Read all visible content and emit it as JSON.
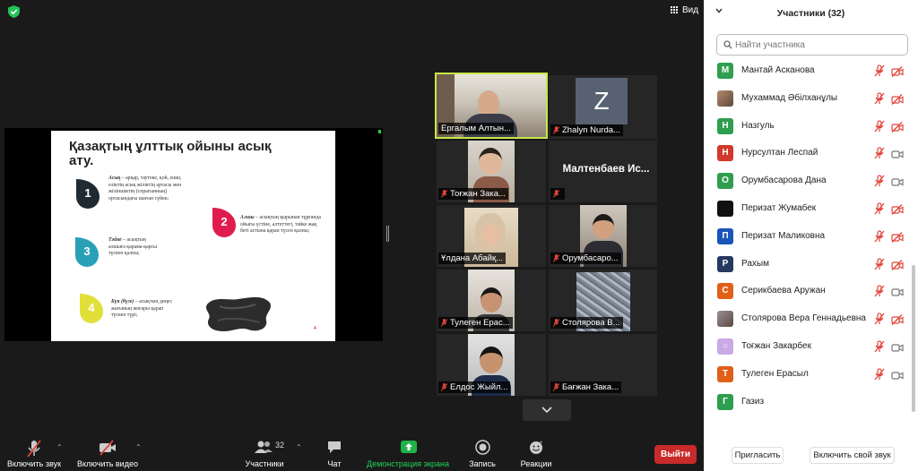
{
  "view_label": "Вид",
  "slide": {
    "title": "Қазақтың ұлттық ойыны асық ату.",
    "points": [
      {
        "num": "1",
        "term": "Асық",
        "text": " – арқар, таутеке, қой, ешкі, еліктің асық жіліктің артасы мен жіліншіктің (спрагынның) ортасындағы шағын сүйек;"
      },
      {
        "num": "2",
        "term": "Алшы",
        "text": " – асықтың қырынан тұрғанда ойығы үстіне, алтеттегі, тәйке жақ беті астына қарап түсен қалпы;"
      },
      {
        "num": "3",
        "term": "Тәйке",
        "text": " – асықтың алшыға қарама-қарсы түскен қалпы;"
      },
      {
        "num": "4",
        "term": "Бүк (бүге)",
        "text": " – асықтың дөңес жағының жоғары қарап түскен түрі;"
      }
    ],
    "page_num": "4"
  },
  "videos": [
    {
      "name": "Ергалым Алтын...",
      "kind": "photo",
      "active": true,
      "muted": false
    },
    {
      "name": "Zhalyn Nurda...",
      "kind": "avatar",
      "letter": "Z",
      "muted": true
    },
    {
      "name": "Тоғжан Зака...",
      "kind": "photo",
      "muted": true
    },
    {
      "name": "",
      "kind": "bigname",
      "big": "Малтенбаев Ис...",
      "muted": true
    },
    {
      "name": "Ұлдана Абайқ...",
      "kind": "photo",
      "muted": false
    },
    {
      "name": "Орумбасаро...",
      "kind": "photo",
      "muted": true
    },
    {
      "name": "Тулеген Ерас...",
      "kind": "photo",
      "muted": true
    },
    {
      "name": "Столярова В...",
      "kind": "photo",
      "muted": true
    },
    {
      "name": "Елдос Жыйл...",
      "kind": "photo",
      "muted": true
    },
    {
      "name": "Бағжан Зака...",
      "kind": "empty",
      "muted": true
    }
  ],
  "toolbar": {
    "unmute": "Включить звук",
    "start_video": "Включить видео",
    "participants": "Участники",
    "participants_count": "32",
    "chat": "Чат",
    "share": "Демонстрация экрана",
    "record": "Запись",
    "reactions": "Реакции",
    "leave": "Выйти"
  },
  "panel": {
    "title": "Участники (32)",
    "search_placeholder": "Найти участника",
    "invite": "Пригласить",
    "unmute_me": "Включить свой звук",
    "participants": [
      {
        "name": "Мантай Асканова",
        "initial": "М",
        "color": "#2e9e4f",
        "mic_muted": true,
        "cam_off": true
      },
      {
        "name": "Мухаммад Әбілханұлы",
        "initial": "",
        "color": "#b58a6a",
        "photo": true,
        "mic_muted": true,
        "cam_off": true
      },
      {
        "name": "Назгуль",
        "initial": "Н",
        "color": "#2e9e4f",
        "mic_muted": true,
        "cam_off": true
      },
      {
        "name": "Нурсултан Леспай",
        "initial": "Н",
        "color": "#d0392b",
        "mic_muted": true,
        "cam_off": false
      },
      {
        "name": "Орумбасарова Дана",
        "initial": "О",
        "color": "#2e9e4f",
        "mic_muted": true,
        "cam_off": false
      },
      {
        "name": "Перизат Жумабек",
        "initial": "",
        "color": "#111111",
        "mic_muted": true,
        "cam_off": true
      },
      {
        "name": "Перизат Маликовна",
        "initial": "П",
        "color": "#1a56b8",
        "mic_muted": true,
        "cam_off": true
      },
      {
        "name": "Рахым",
        "initial": "Р",
        "color": "#26395e",
        "mic_muted": true,
        "cam_off": true
      },
      {
        "name": "Серикбаева Аружан",
        "initial": "С",
        "color": "#e06018",
        "mic_muted": true,
        "cam_off": false
      },
      {
        "name": "Столярова Вера Геннадьевна",
        "initial": "",
        "color": "#9a8f98",
        "photo": true,
        "mic_muted": true,
        "cam_off": true
      },
      {
        "name": "Тоғжан Закарбек",
        "initial": "○",
        "color": "#c9a9e6",
        "mic_muted": true,
        "cam_off": false
      },
      {
        "name": "Тулеген Ерасыл",
        "initial": "Т",
        "color": "#e06018",
        "mic_muted": true,
        "cam_off": false
      },
      {
        "name": "Газиз",
        "initial": "Г",
        "color": "#2e9e4f",
        "mic_muted": false,
        "cam_off": false,
        "no_icons": true
      }
    ]
  },
  "colors": {
    "active_border": "#c8e64a",
    "share_green": "#20b34a",
    "leave_red": "#c92a2a",
    "muted_red": "#e0443a"
  }
}
